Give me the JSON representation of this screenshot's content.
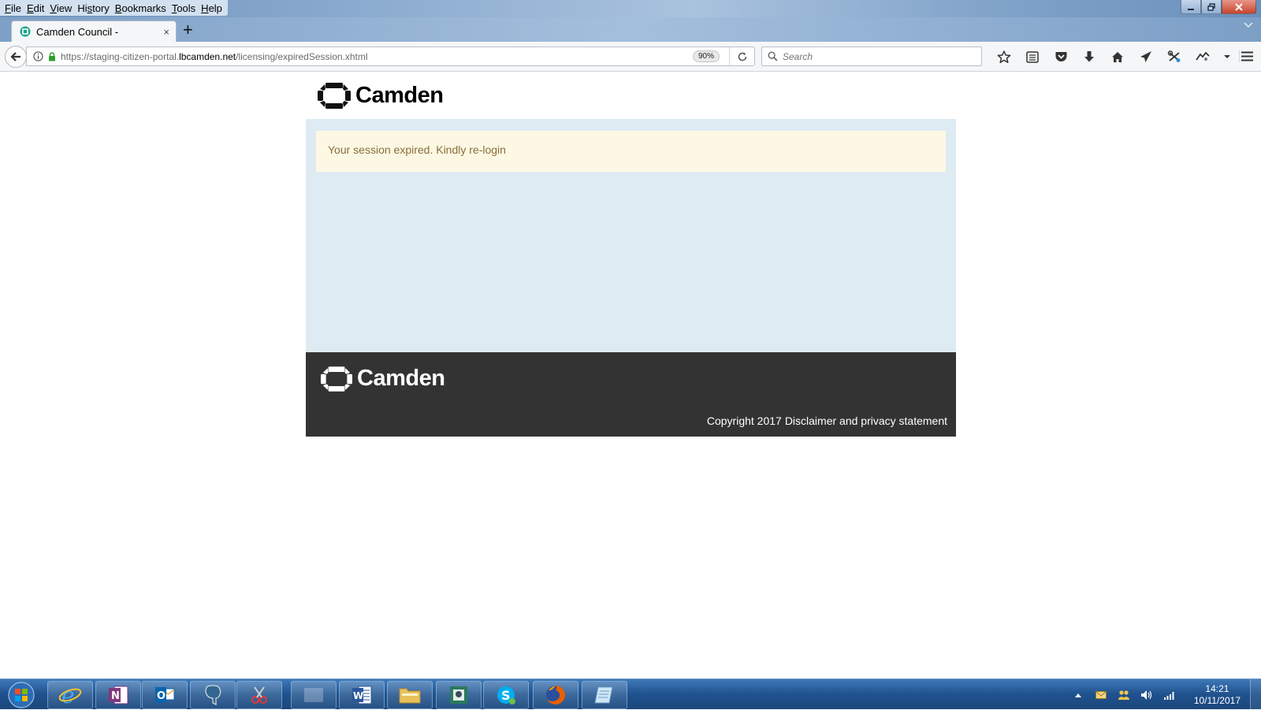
{
  "menu": {
    "items": [
      {
        "accel": "F",
        "rest": "ile"
      },
      {
        "accel": "E",
        "rest": "dit"
      },
      {
        "accel": "V",
        "rest": "iew"
      },
      {
        "pre": "Hi",
        "accel": "s",
        "rest": "tory"
      },
      {
        "accel": "B",
        "rest": "ookmarks"
      },
      {
        "accel": "T",
        "rest": "ools"
      },
      {
        "accel": "H",
        "rest": "elp"
      }
    ]
  },
  "tab": {
    "title": "Camden Council -",
    "close": "×"
  },
  "newtab_label": "+",
  "url": {
    "prefix": "https://staging-citizen-portal.",
    "host": "lbcamden.net",
    "path": "/licensing/expiredSession.xhtml"
  },
  "zoom": "90%",
  "search": {
    "placeholder": "Search"
  },
  "toolbar": {
    "icons": [
      "bookmark-star-icon",
      "reading-list-icon",
      "pocket-icon",
      "download-icon",
      "home-icon",
      "send-icon",
      "extension-icon",
      "addon-icon",
      "overflow-chevron-icon"
    ]
  },
  "site": {
    "brand": "Camden",
    "alert": "Your session expired. Kindly re-login",
    "footer": {
      "copyright": "Copyright 2017",
      "disclaimer": "Disclaimer and privacy statement"
    }
  },
  "taskbar": {
    "apps": [
      "internet-explorer-icon",
      "onenote-icon",
      "outlook-icon",
      "postgres-icon",
      "snipping-tool-icon",
      "blank-window-icon",
      "word-icon",
      "file-explorer-icon",
      "app-window-icon",
      "skype-icon",
      "firefox-icon",
      "notepad-icon"
    ],
    "clock_time": "14:21",
    "clock_date": "10/11/2017"
  },
  "colors": {
    "alert_bg": "#fcf8e3",
    "alert_text": "#8a6d3b",
    "main_bg": "#deebf3",
    "footer_bg": "#333333"
  }
}
